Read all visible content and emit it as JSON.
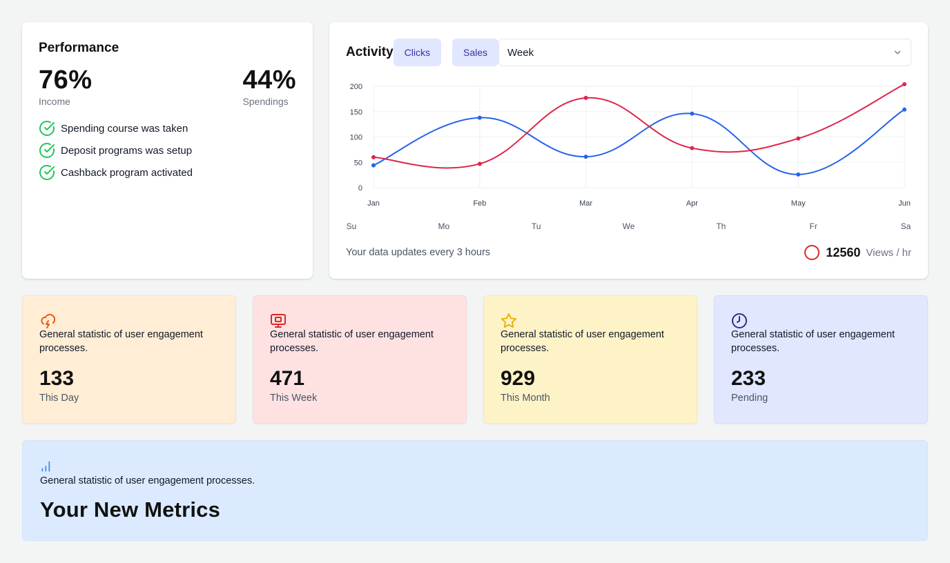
{
  "performance": {
    "title": "Performance",
    "income_value": "76%",
    "income_label": "Income",
    "spendings_value": "44%",
    "spendings_label": "Spendings",
    "checklist": [
      "Spending course was taken",
      "Deposit programs was setup",
      "Cashback program activated"
    ],
    "check_color": "#22c55e"
  },
  "activity": {
    "title": "Activity",
    "tabs": [
      "Clicks",
      "Sales"
    ],
    "period_select": "Week",
    "footer_note": "Your data updates every 3 hours",
    "views_value": "12560",
    "views_unit": "Views / hr"
  },
  "chart_data": {
    "type": "line",
    "categories": [
      "Jan",
      "Feb",
      "Mar",
      "Apr",
      "May",
      "Jun"
    ],
    "secondary_labels": [
      "Su",
      "Mo",
      "Tu",
      "We",
      "Th",
      "Fr",
      "Sa"
    ],
    "ylim": [
      0,
      200
    ],
    "yticks": [
      0,
      50,
      100,
      150,
      200
    ],
    "grid": true,
    "series": [
      {
        "color": "#2563eb",
        "values": [
          44,
          138,
          61,
          146,
          26,
          154
        ]
      },
      {
        "color": "#dc2648",
        "values": [
          60,
          47,
          177,
          78,
          97,
          204
        ]
      }
    ]
  },
  "stat_cards": [
    {
      "icon": "cloud-lightning-icon",
      "desc": "General statistic of user engagement processes.",
      "value": "133",
      "label": "This Day",
      "bg": "#ffedd5",
      "icon_color": "#ea580c"
    },
    {
      "icon": "presentation-icon",
      "desc": "General statistic of user engagement processes.",
      "value": "471",
      "label": "This Week",
      "bg": "#fee2e2",
      "icon_color": "#dc2626"
    },
    {
      "icon": "star-icon",
      "desc": "General statistic of user engagement processes.",
      "value": "929",
      "label": "This Month",
      "bg": "#fef3c7",
      "icon_color": "#eab308"
    },
    {
      "icon": "clock-icon",
      "desc": "General statistic of user engagement processes.",
      "value": "233",
      "label": "Pending",
      "bg": "#e0e7ff",
      "icon_color": "#312e81"
    }
  ],
  "metrics": {
    "icon": "bar-chart-icon",
    "icon_color": "#3b82f6",
    "desc": "General statistic of user engagement processes.",
    "heading": "Your New Metrics"
  }
}
